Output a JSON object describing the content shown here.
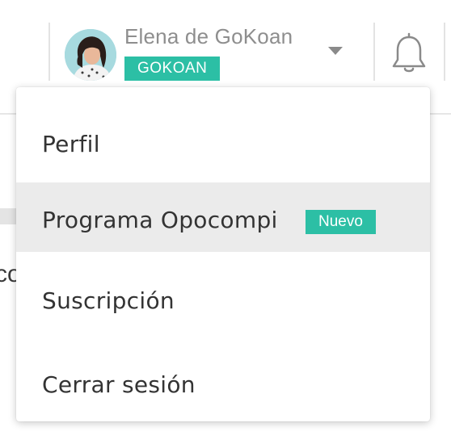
{
  "header": {
    "user": {
      "name": "Elena de GoKoan",
      "organization_badge": "GOKOAN",
      "avatar_icon": "user-avatar-photo",
      "caret_icon": "caret-down-icon"
    },
    "notifications_icon": "bell-icon"
  },
  "background": {
    "partial_text": "co"
  },
  "dropdown": {
    "items": [
      {
        "label": "Perfil"
      },
      {
        "label": "Programa Opocompi",
        "badge": "Nuevo",
        "highlighted": true
      },
      {
        "label": "Suscripción"
      },
      {
        "label": "Cerrar sesión"
      }
    ]
  },
  "colors": {
    "accent": "#2cbfa5",
    "hover_bg": "#ebebeb",
    "text": "#333333",
    "muted_text": "#8e8e8e"
  }
}
